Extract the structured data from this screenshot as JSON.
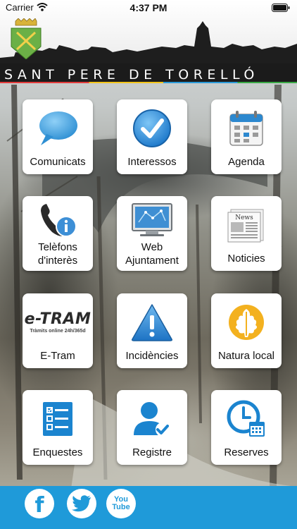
{
  "status_bar": {
    "carrier": "Carrier",
    "time": "4:37 PM"
  },
  "header": {
    "town_name": "SANT PERE DE TORELLÓ"
  },
  "tiles": [
    {
      "label": "Comunicats",
      "icon": "speech-bubble-icon"
    },
    {
      "label": "Interessos",
      "icon": "checkmark-icon"
    },
    {
      "label": "Agenda",
      "icon": "calendar-icon"
    },
    {
      "label": "Telèfons d'interès",
      "icon": "phone-info-icon"
    },
    {
      "label": "Web Ajuntament",
      "icon": "monitor-icon"
    },
    {
      "label": "Noticies",
      "icon": "newspaper-icon"
    },
    {
      "label": "E-Tram",
      "icon": "etram-logo-icon",
      "logo_title": "e-TRAM",
      "logo_subtitle": "Tràmits online 24h/365d"
    },
    {
      "label": "Incidències",
      "icon": "warning-icon"
    },
    {
      "label": "Natura local",
      "icon": "oak-leaf-icon"
    },
    {
      "label": "Enquestes",
      "icon": "checklist-icon"
    },
    {
      "label": "Registre",
      "icon": "user-check-icon"
    },
    {
      "label": "Reserves",
      "icon": "clock-calendar-icon"
    }
  ],
  "social": [
    {
      "name": "facebook",
      "glyph": "f"
    },
    {
      "name": "twitter",
      "glyph": ""
    },
    {
      "name": "youtube",
      "glyph": "You Tube"
    }
  ],
  "colors": {
    "footer": "#1f9ad9",
    "accent_blue": "#2a8fd0"
  }
}
